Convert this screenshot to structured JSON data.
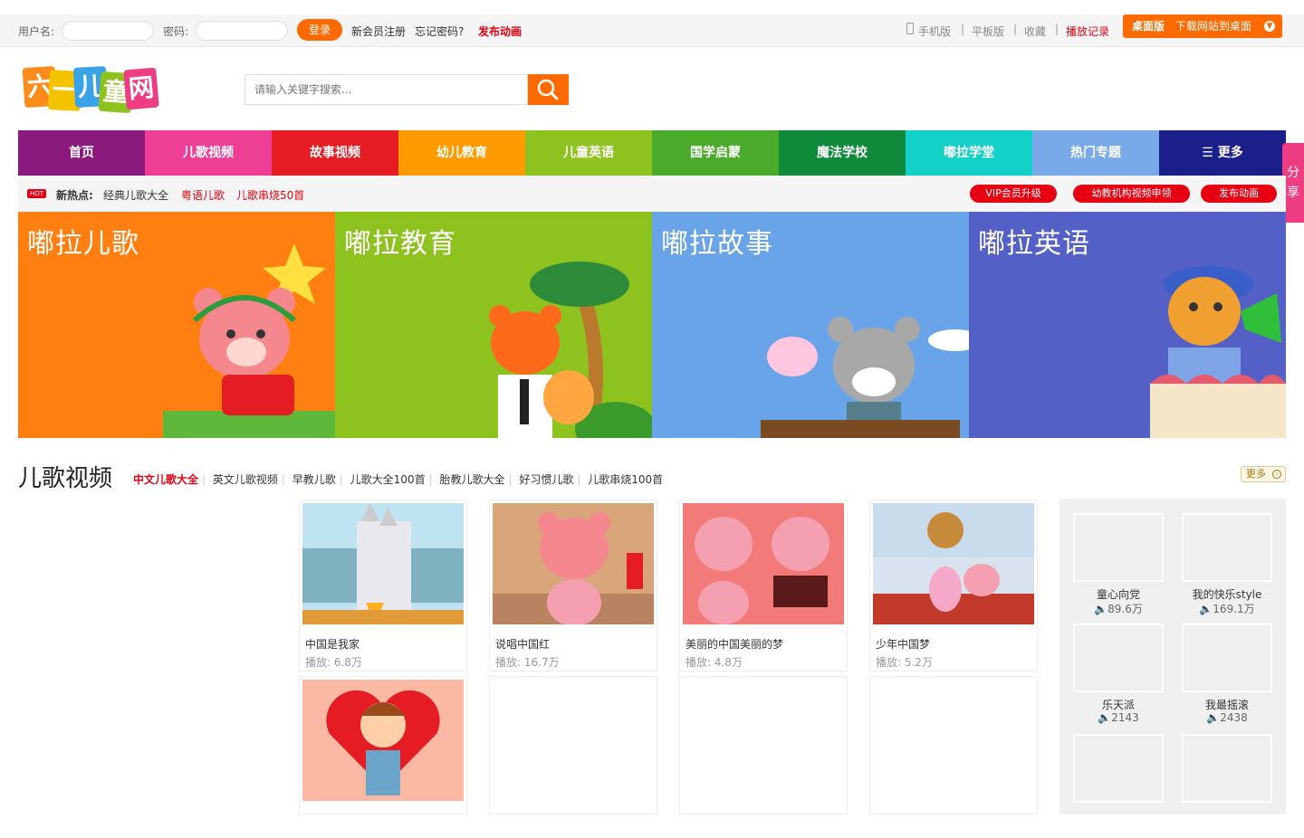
{
  "topbar": {
    "username_label": "用户名:",
    "password_label": "密码:",
    "login_label": "登录",
    "register_label": "新会员注册",
    "forgot_label": "忘记密码?",
    "publish_label": "发布动画",
    "mobile_label": "手机版",
    "tablet_label": "平板版",
    "favorite_label": "收藏",
    "history_label": "播放记录",
    "desktop_label": "桌面版",
    "download_label": "下载网站到桌面"
  },
  "logo": {
    "text": "六一儿童网",
    "chars": [
      "六",
      "一",
      "儿",
      "童",
      "网"
    ]
  },
  "search": {
    "placeholder": "请输入关键字搜索..."
  },
  "nav": {
    "items": [
      {
        "label": "首页",
        "color": "#8b1a7e"
      },
      {
        "label": "儿歌视频",
        "color": "#ee3f94"
      },
      {
        "label": "故事视频",
        "color": "#e51c23"
      },
      {
        "label": "幼儿教育",
        "color": "#ff9a00"
      },
      {
        "label": "儿童英语",
        "color": "#8ec31f"
      },
      {
        "label": "国学启蒙",
        "color": "#4aab2a"
      },
      {
        "label": "魔法学校",
        "color": "#0e8a3a"
      },
      {
        "label": "嘟拉学堂",
        "color": "#13d1c7"
      },
      {
        "label": "热门专题",
        "color": "#7aa9ea"
      },
      {
        "label": "更多",
        "color": "#1c1f8a"
      }
    ]
  },
  "hotbar": {
    "hot_badge": "HOT",
    "label": "新热点:",
    "links": [
      "经典儿歌大全",
      "粤语儿歌",
      "儿歌串烧50首"
    ],
    "pills": [
      "VIP会员升级",
      "幼教机构视频申领",
      "发布动画"
    ]
  },
  "share": {
    "label": "分享"
  },
  "banners": [
    {
      "title": "嘟拉儿歌",
      "color": "#ff7f10"
    },
    {
      "title": "嘟拉教育",
      "color": "#8ec31f"
    },
    {
      "title": "嘟拉故事",
      "color": "#6aa4e8"
    },
    {
      "title": "嘟拉英语",
      "color": "#5560c6"
    }
  ],
  "section": {
    "title": "儿歌视频",
    "tabs": [
      "中文儿歌大全",
      "英文儿歌视频",
      "早教儿歌",
      "儿歌大全100首",
      "胎教儿歌大全",
      "好习惯儿歌",
      "儿歌串烧100首"
    ],
    "more_label": "更多"
  },
  "videos": [
    {
      "title": "中国是我家",
      "plays": "播放: 6.8万"
    },
    {
      "title": "说唱中国红",
      "plays": "播放: 16.7万"
    },
    {
      "title": "美丽的中国美丽的梦",
      "plays": "播放: 4.8万"
    },
    {
      "title": "少年中国梦",
      "plays": "播放: 5.2万"
    }
  ],
  "sidebar": [
    {
      "name": "童心向党",
      "count": "89.6万"
    },
    {
      "name": "我的快乐style",
      "count": "169.1万"
    },
    {
      "name": "乐天派",
      "count": "2143"
    },
    {
      "name": "我最摇滚",
      "count": "2438"
    }
  ]
}
